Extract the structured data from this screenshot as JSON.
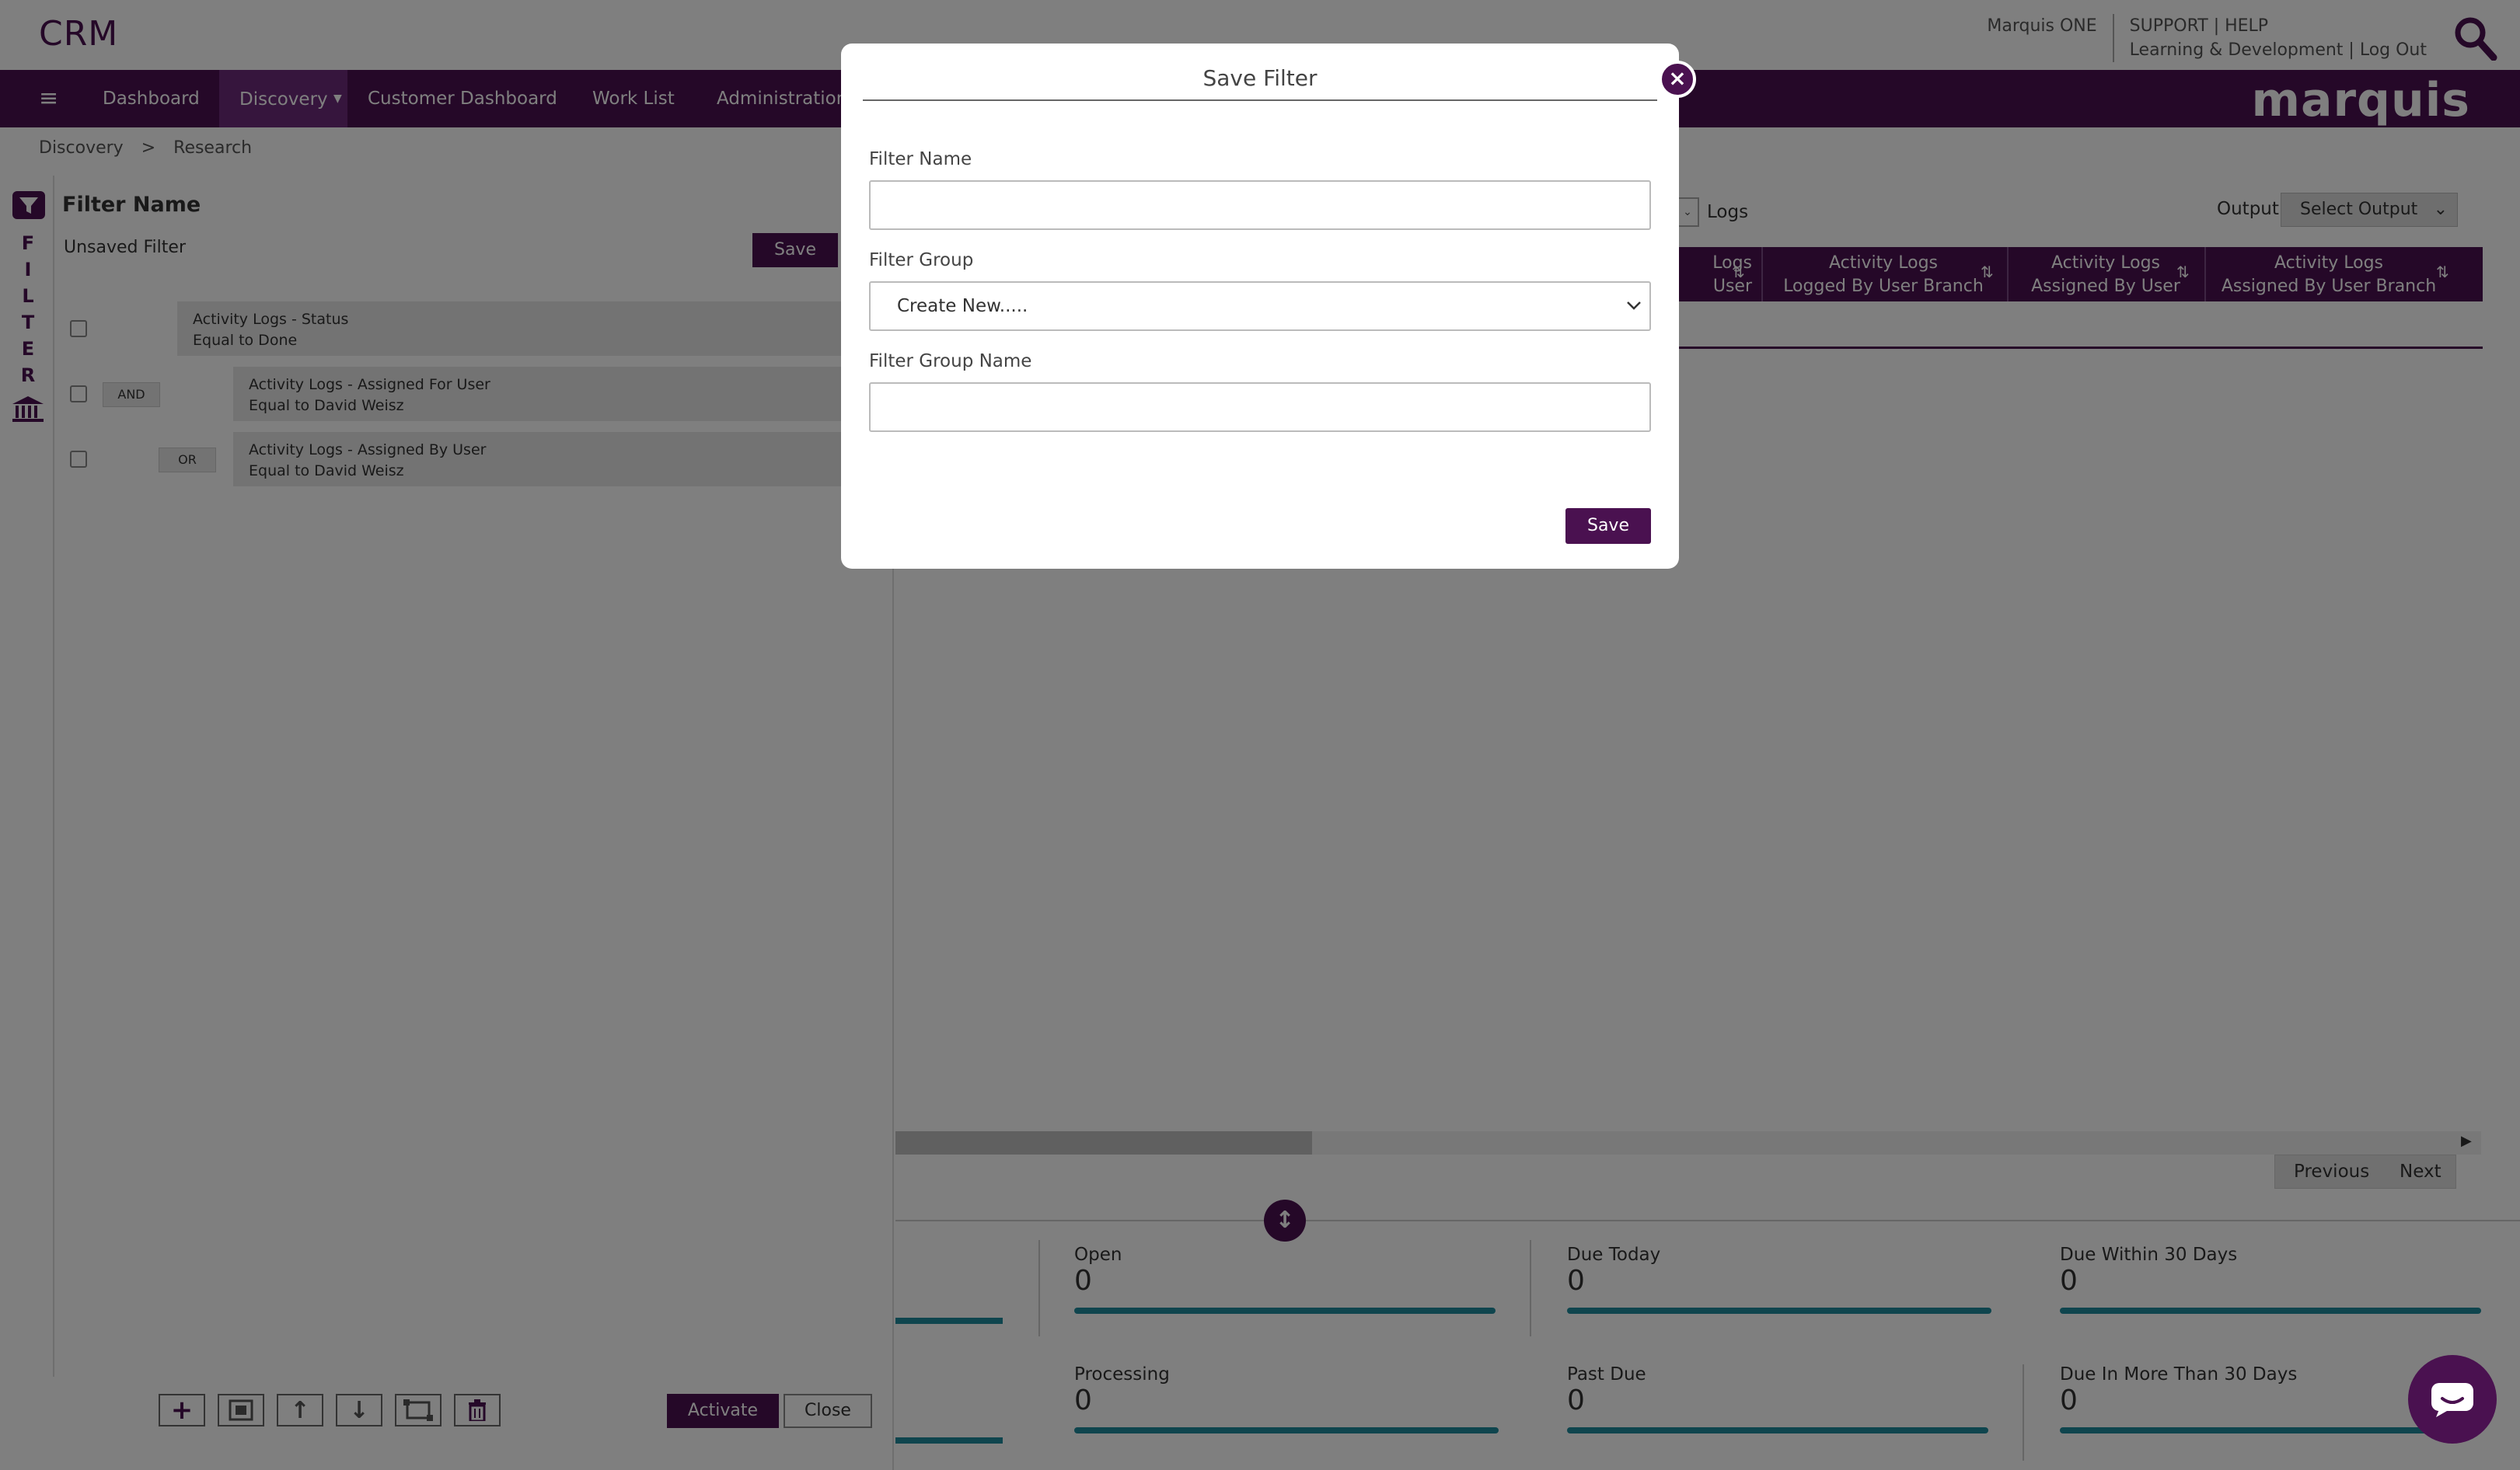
{
  "app": {
    "title": "CRM"
  },
  "header": {
    "brand_link": "Marquis ONE",
    "links_row1": "SUPPORT | HELP",
    "links_row2": "Learning & Development | Log Out",
    "logo": "marquis"
  },
  "nav": {
    "items": [
      {
        "label": "Dashboard"
      },
      {
        "label": "Discovery"
      },
      {
        "label": "Customer Dashboard"
      },
      {
        "label": "Work List"
      },
      {
        "label": "Administration"
      }
    ],
    "active": "Discovery"
  },
  "breadcrumb": {
    "parent": "Discovery",
    "sep": ">",
    "current": "Research"
  },
  "filter_panel": {
    "vertical_label": [
      "F",
      "I",
      "L",
      "T",
      "E",
      "R"
    ],
    "title": "Filter Name",
    "status": "Unsaved Filter",
    "save_label": "Save",
    "rules": [
      {
        "operator": "",
        "line1": "Activity Logs - Status",
        "line2": "Equal to Done"
      },
      {
        "operator": "AND",
        "line1": "Activity Logs - Assigned For User",
        "line2": "Equal to David Weisz"
      },
      {
        "operator": "OR",
        "line1": "Activity Logs - Assigned By User",
        "line2": "Equal to David Weisz"
      }
    ],
    "activate_label": "Activate",
    "close_label": "Close"
  },
  "results": {
    "view_suffix": "Logs",
    "output_label": "Output",
    "output_select": "Select Output",
    "columns": [
      {
        "line1": "Logs",
        "line2": "User"
      },
      {
        "line1": "Activity Logs",
        "line2": "Logged By User Branch"
      },
      {
        "line1": "Activity Logs",
        "line2": "Assigned By User"
      },
      {
        "line1": "Activity Logs",
        "line2": "Assigned By User Branch"
      }
    ],
    "prev_label": "Previous",
    "next_label": "Next"
  },
  "stats": [
    {
      "label": "Open",
      "value": "0"
    },
    {
      "label": "Due Today",
      "value": "0"
    },
    {
      "label": "Due Within 30 Days",
      "value": "0"
    },
    {
      "label": "Processing",
      "value": "0"
    },
    {
      "label": "Past Due",
      "value": "0"
    },
    {
      "label": "Due In More Than 30 Days",
      "value": "0"
    }
  ],
  "modal": {
    "title": "Save Filter",
    "filter_name_label": "Filter Name",
    "filter_name_value": "",
    "filter_group_label": "Filter Group",
    "filter_group_selected": "Create New.....",
    "filter_group_name_label": "Filter Group Name",
    "filter_group_name_value": "",
    "save_label": "Save"
  },
  "colors": {
    "brand": "#4a1150",
    "accent": "#1f8a9c"
  }
}
